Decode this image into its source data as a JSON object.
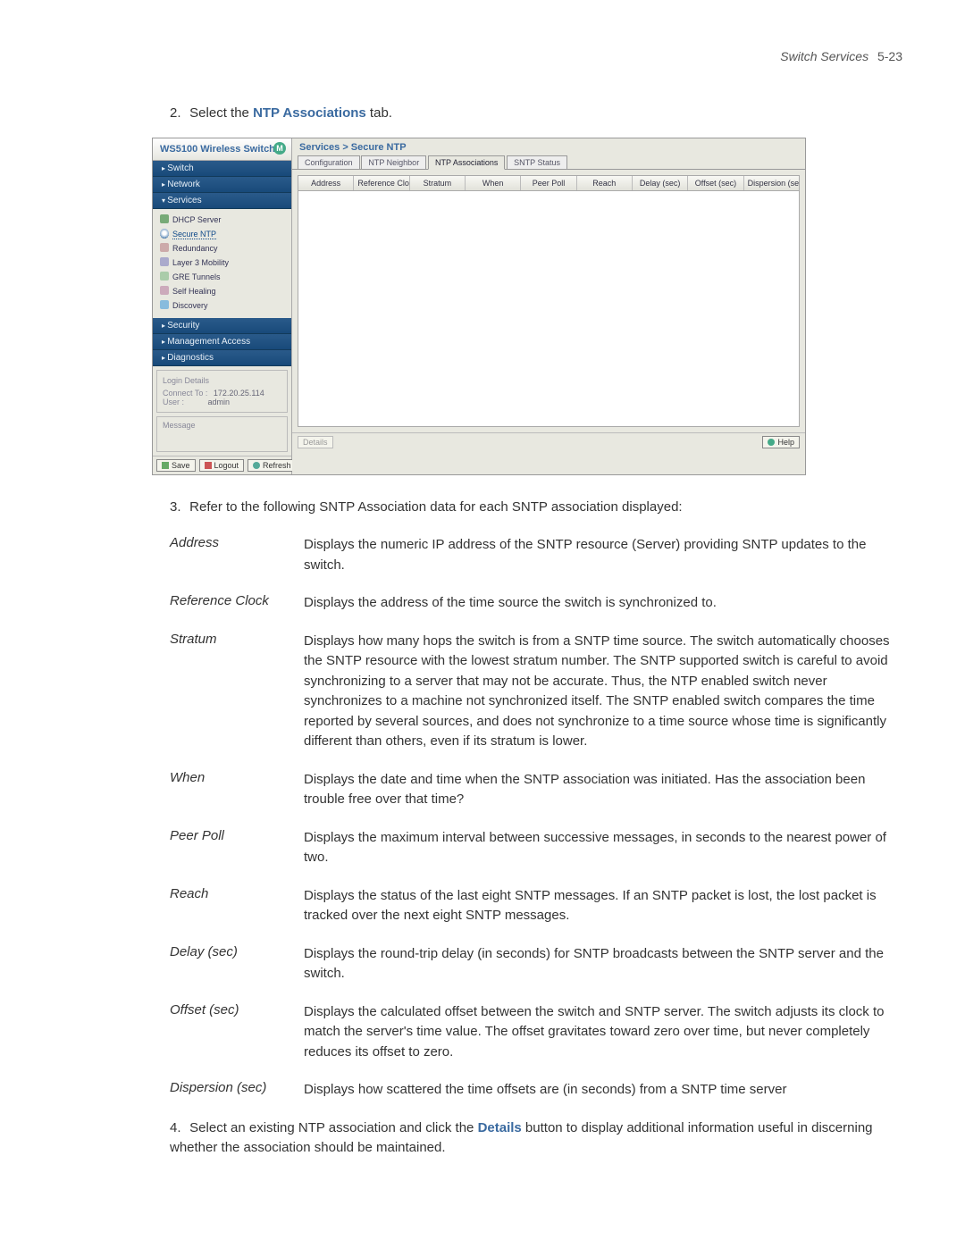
{
  "header": {
    "title": "Switch Services",
    "pagenum": "5-23"
  },
  "step2": {
    "num": "2.",
    "prefix": "Select the ",
    "link": "NTP Associations",
    "suffix": " tab."
  },
  "step3": {
    "num": "3.",
    "text": "Refer to the following SNTP Association data for each SNTP association displayed:"
  },
  "step4": {
    "num": "4.",
    "p1": "Select an existing NTP association and click the ",
    "link": "Details",
    "p2": " button to display additional information useful in discerning whether the association should be maintained."
  },
  "shot": {
    "product": "WS5100 Wireless Switch",
    "crumb": "Services > Secure NTP",
    "nav": {
      "switch": "Switch",
      "network": "Network",
      "services": "Services",
      "security": "Security",
      "mgmt": "Management Access",
      "diag": "Diagnostics"
    },
    "tree": {
      "dhcp": "DHCP Server",
      "sntp": "Secure NTP",
      "redund": "Redundancy",
      "l3": "Layer 3 Mobility",
      "gre": "GRE Tunnels",
      "heal": "Self Healing",
      "disc": "Discovery"
    },
    "tabs": {
      "t1": "Configuration",
      "t2": "NTP Neighbor",
      "t3": "NTP Associations",
      "t4": "SNTP Status"
    },
    "columns": {
      "c1": "Address",
      "c2": "Reference Clock",
      "c3": "Stratum",
      "c4": "When",
      "c5": "Peer Poll",
      "c6": "Reach",
      "c7": "Delay (sec)",
      "c8": "Offset (sec)",
      "c9": "Dispersion (sec)"
    },
    "login": {
      "title": "Login Details",
      "connLbl": "Connect To :",
      "connVal": "172.20.25.114",
      "userLbl": "User :",
      "userVal": "admin"
    },
    "message": "Message",
    "buttons": {
      "save": "Save",
      "logout": "Logout",
      "refresh": "Refresh",
      "details": "Details",
      "help": "Help"
    }
  },
  "defs": [
    {
      "term": "Address",
      "desc": "Displays the numeric IP address of the SNTP resource (Server) providing SNTP updates to the switch."
    },
    {
      "term": "Reference Clock",
      "desc": "Displays the address of the time source the switch is synchronized to."
    },
    {
      "term": "Stratum",
      "desc": "Displays how many hops the switch is from a SNTP time source. The switch automatically chooses the SNTP resource with the lowest stratum number. The SNTP supported switch is careful to avoid synchronizing to a server that may not be accurate. Thus, the NTP enabled switch never synchronizes to a machine not synchronized itself. The SNTP enabled switch compares the time reported by several sources, and does not synchronize to a time source whose time is significantly different than others, even if its stratum is lower."
    },
    {
      "term": "When",
      "desc": "Displays the date and time when the SNTP association was initiated. Has the association been trouble free over that time?"
    },
    {
      "term": "Peer Poll",
      "desc": "Displays the maximum interval between successive messages, in seconds to the nearest power of two."
    },
    {
      "term": "Reach",
      "desc": "Displays the status of the last eight SNTP messages. If an SNTP packet is lost, the lost packet is tracked over the next eight SNTP messages."
    },
    {
      "term": "Delay (sec)",
      "desc": "Displays the round-trip delay (in seconds) for SNTP broadcasts between the SNTP server and the switch."
    },
    {
      "term": "Offset (sec)",
      "desc": "Displays the calculated offset between the switch and SNTP server. The switch adjusts its clock to match the server's time value. The offset gravitates toward zero over time, but never completely reduces its offset to zero."
    },
    {
      "term": "Dispersion (sec)",
      "desc": "Displays how scattered the time offsets are (in seconds) from a SNTP time server"
    }
  ]
}
